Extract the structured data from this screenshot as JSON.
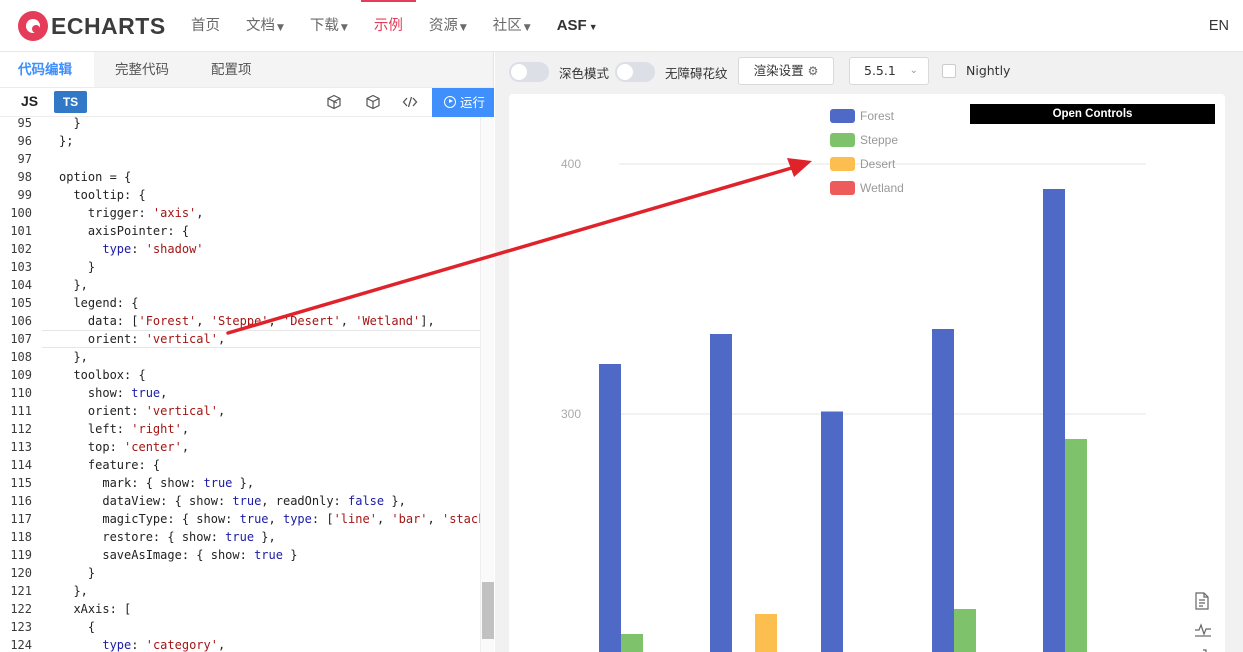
{
  "nav": {
    "logo_text": "ECHARTS",
    "items": [
      {
        "label": "首页",
        "caret": false
      },
      {
        "label": "文档",
        "caret": true
      },
      {
        "label": "下载",
        "caret": true
      },
      {
        "label": "示例",
        "caret": false,
        "active": true
      },
      {
        "label": "资源",
        "caret": true
      },
      {
        "label": "社区",
        "caret": true
      },
      {
        "label": "ASF",
        "caret": true,
        "strong": true
      }
    ],
    "lang": "EN",
    "accent_color": "#e43c59"
  },
  "editor": {
    "tabs": [
      {
        "label": "代码编辑",
        "active": true
      },
      {
        "label": "完整代码"
      },
      {
        "label": "配置项"
      }
    ],
    "lang_js": "JS",
    "lang_ts": "TS",
    "toolbar_icons": [
      "cube-outline-icon",
      "cube-icon",
      "code-icon"
    ],
    "run_label": "运行",
    "current_line": 107,
    "lines": [
      {
        "n": "95",
        "code": "  }"
      },
      {
        "n": "96",
        "code": "};"
      },
      {
        "n": "97",
        "code": ""
      },
      {
        "n": "98",
        "code": "option = {"
      },
      {
        "n": "99",
        "code": "  tooltip: {"
      },
      {
        "n": "100",
        "code": "    trigger: 'axis',"
      },
      {
        "n": "101",
        "code": "    axisPointer: {"
      },
      {
        "n": "102",
        "code": "      type: 'shadow'"
      },
      {
        "n": "103",
        "code": "    }"
      },
      {
        "n": "104",
        "code": "  },"
      },
      {
        "n": "105",
        "code": "  legend: {"
      },
      {
        "n": "106",
        "code": "    data: ['Forest', 'Steppe', 'Desert', 'Wetland'],"
      },
      {
        "n": "107",
        "code": "    orient: 'vertical',"
      },
      {
        "n": "108",
        "code": "  },"
      },
      {
        "n": "109",
        "code": "  toolbox: {"
      },
      {
        "n": "110",
        "code": "    show: true,"
      },
      {
        "n": "111",
        "code": "    orient: 'vertical',"
      },
      {
        "n": "112",
        "code": "    left: 'right',"
      },
      {
        "n": "113",
        "code": "    top: 'center',"
      },
      {
        "n": "114",
        "code": "    feature: {"
      },
      {
        "n": "115",
        "code": "      mark: { show: true },"
      },
      {
        "n": "116",
        "code": "      dataView: { show: true, readOnly: false },"
      },
      {
        "n": "117",
        "code": "      magicType: { show: true, type: ['line', 'bar', 'stack']"
      },
      {
        "n": "118",
        "code": "      restore: { show: true },"
      },
      {
        "n": "119",
        "code": "      saveAsImage: { show: true }"
      },
      {
        "n": "120",
        "code": "    }"
      },
      {
        "n": "121",
        "code": "  },"
      },
      {
        "n": "122",
        "code": "  xAxis: ["
      },
      {
        "n": "123",
        "code": "    {"
      },
      {
        "n": "124",
        "code": "      type: 'category',"
      }
    ]
  },
  "preview": {
    "dark_mode_label": "深色模式",
    "a11y_label": "无障碍花纹",
    "render_settings_label": "渲染设置",
    "version": "5.5.1",
    "nightly_label": "Nightly",
    "open_controls_label": "Open Controls"
  },
  "chart_data": {
    "type": "bar",
    "title": "",
    "legend": [
      {
        "name": "Forest",
        "color": "#4f69c6"
      },
      {
        "name": "Steppe",
        "color": "#7ec26b"
      },
      {
        "name": "Desert",
        "color": "#fbbe4f"
      },
      {
        "name": "Wetland",
        "color": "#ed5b5b"
      }
    ],
    "y_ticks": [
      "400",
      "300"
    ],
    "ylim_visible": [
      270,
      420
    ],
    "groups": [
      [
        {
          "series": "Forest",
          "value": 320
        },
        {
          "series": "Steppe",
          "value": 212
        }
      ],
      [
        {
          "series": "Forest",
          "value": 332
        },
        {
          "series": "Desert",
          "value": 220
        }
      ],
      [
        {
          "series": "Forest",
          "value": 301
        }
      ],
      [
        {
          "series": "Forest",
          "value": 334
        },
        {
          "series": "Steppe",
          "value": 222
        }
      ],
      [
        {
          "series": "Forest",
          "value": 390
        },
        {
          "series": "Steppe",
          "value": 290
        }
      ]
    ],
    "toolbox_icons": [
      "data-view-icon",
      "line-chart-icon",
      "bar-chart-icon"
    ]
  },
  "annotation": {
    "arrow_color": "#e0232b"
  }
}
